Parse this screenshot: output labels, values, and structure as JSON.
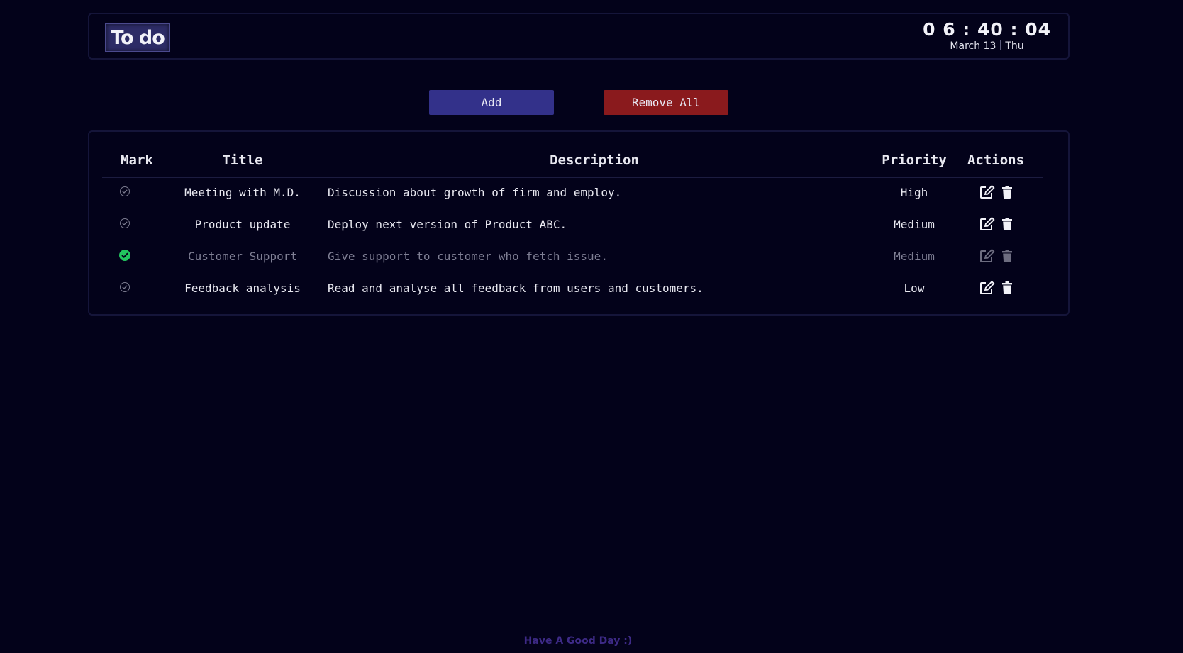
{
  "header": {
    "logo": "To do",
    "clock": {
      "time": "0 6 : 40 : 04",
      "date": "March  13",
      "day": "Thu"
    }
  },
  "toolbar": {
    "add_label": "Add",
    "remove_all_label": "Remove All"
  },
  "table": {
    "columns": {
      "mark": "Mark",
      "title": "Title",
      "description": "Description",
      "priority": "Priority",
      "actions": "Actions"
    },
    "rows": [
      {
        "done": false,
        "title": "Meeting with M.D.",
        "description": "Discussion about growth of firm and employ.",
        "priority": "High"
      },
      {
        "done": false,
        "title": "Product update",
        "description": "Deploy next version of Product ABC.",
        "priority": "Medium"
      },
      {
        "done": true,
        "title": "Customer Support",
        "description": "Give support to customer who fetch issue.",
        "priority": "Medium"
      },
      {
        "done": false,
        "title": "Feedback analysis",
        "description": "Read and analyse all feedback from users and customers.",
        "priority": "Low"
      }
    ]
  },
  "footer": {
    "text": "Have A Good Day :)"
  },
  "colors": {
    "background": "#03021a",
    "add_button": "#33318a",
    "remove_button": "#8a1a1d",
    "done_check": "#22c55e",
    "footer_text": "#3d2a86"
  }
}
